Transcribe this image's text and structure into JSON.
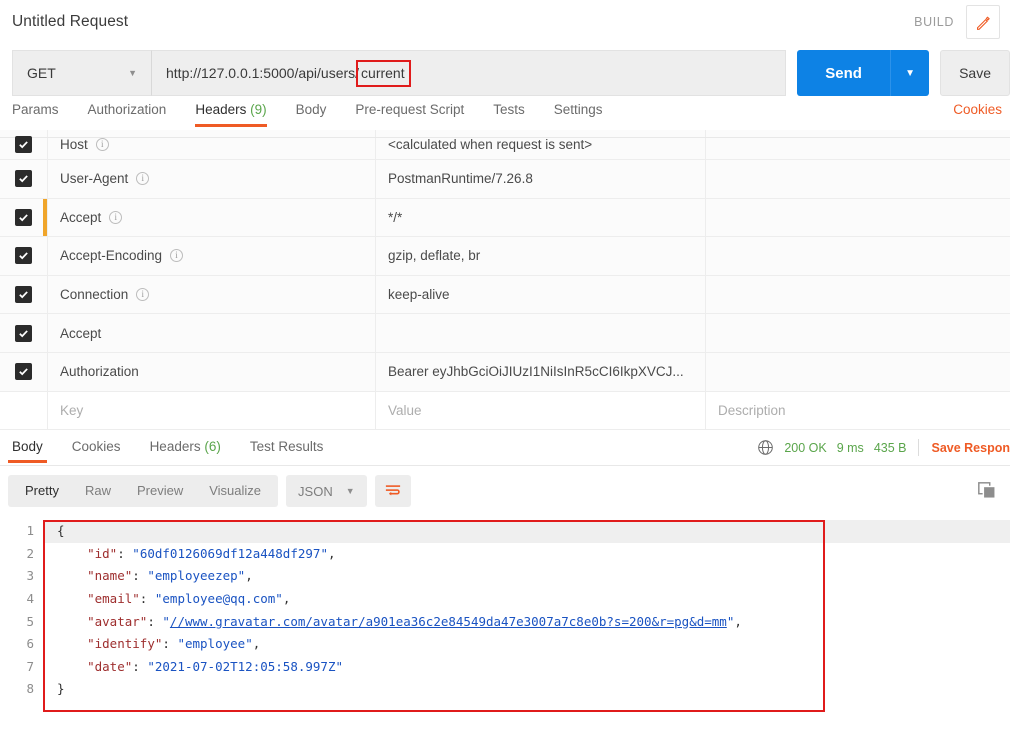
{
  "titlebar": {
    "request_title": "Untitled Request",
    "build_label": "BUILD",
    "edit_icon": "pencil-icon"
  },
  "url_bar": {
    "method": "GET",
    "url_prefix": "http://127.0.0.1:5000/api/users/",
    "url_highlighted": "current",
    "send_label": "Send",
    "save_label": "Save"
  },
  "request_tabs": {
    "items": [
      {
        "label": "Params",
        "count": "",
        "active": false
      },
      {
        "label": "Authorization",
        "count": "",
        "active": false
      },
      {
        "label": "Headers",
        "count": "(9)",
        "active": true
      },
      {
        "label": "Body",
        "count": "",
        "active": false
      },
      {
        "label": "Pre-request Script",
        "count": "",
        "active": false
      },
      {
        "label": "Tests",
        "count": "",
        "active": false
      },
      {
        "label": "Settings",
        "count": "",
        "active": false
      }
    ],
    "cookies_link": "Cookies"
  },
  "headers_table": {
    "columns": {
      "key": "Key",
      "value": "Value",
      "description": "Description"
    },
    "rows": [
      {
        "checked": true,
        "key": "Host",
        "info": true,
        "value": "<calculated when request is sent>",
        "description": "",
        "marker": false
      },
      {
        "checked": true,
        "key": "User-Agent",
        "info": true,
        "value": "PostmanRuntime/7.26.8",
        "description": "",
        "marker": false
      },
      {
        "checked": true,
        "key": "Accept",
        "info": true,
        "value": "*/*",
        "description": "",
        "marker": true
      },
      {
        "checked": true,
        "key": "Accept-Encoding",
        "info": true,
        "value": "gzip, deflate, br",
        "description": "",
        "marker": false
      },
      {
        "checked": true,
        "key": "Connection",
        "info": true,
        "value": "keep-alive",
        "description": "",
        "marker": false
      },
      {
        "checked": true,
        "key": "Accept",
        "info": false,
        "value": "",
        "description": "",
        "marker": false
      },
      {
        "checked": true,
        "key": "Authorization",
        "info": false,
        "value": "Bearer eyJhbGciOiJIUzI1NiIsInR5cCI6IkpXVCJ...",
        "description": "",
        "marker": false
      }
    ]
  },
  "response_tabs": {
    "items": [
      {
        "label": "Body",
        "count": "",
        "active": true
      },
      {
        "label": "Cookies",
        "count": "",
        "active": false
      },
      {
        "label": "Headers",
        "count": "(6)",
        "active": false
      },
      {
        "label": "Test Results",
        "count": "",
        "active": false
      }
    ],
    "status": "200 OK",
    "time": "9 ms",
    "size": "435 B",
    "save_response": "Save Respon",
    "globe_icon": "globe-icon"
  },
  "body_toolbar": {
    "views": [
      {
        "label": "Pretty",
        "active": true
      },
      {
        "label": "Raw",
        "active": false
      },
      {
        "label": "Preview",
        "active": false
      },
      {
        "label": "Visualize",
        "active": false
      }
    ],
    "format": "JSON",
    "wrap_icon": "word-wrap-icon",
    "copy_icon": "copy-icon"
  },
  "json_body": {
    "line_numbers": [
      "1",
      "2",
      "3",
      "4",
      "5",
      "6",
      "7",
      "8"
    ],
    "raw": "{\n    \"id\": \"60df0126069df12a448df297\",\n    \"name\": \"employeezep\",\n    \"email\": \"employee@qq.com\",\n    \"avatar\": \"//www.gravatar.com/avatar/a901ea36c2e84549da47e3007a7c8e0b?s=200&r=pg&d=mm\",\n    \"identify\": \"employee\",\n    \"date\": \"2021-07-02T12:05:58.997Z\"\n}",
    "fields": {
      "id": "60df0126069df12a448df297",
      "name": "employeezep",
      "email": "employee@qq.com",
      "avatar": "//www.gravatar.com/avatar/a901ea36c2e84549da47e3007a7c8e0b?s=200&r=pg&d=mm",
      "identify": "employee",
      "date": "2021-07-02T12:05:58.997Z"
    },
    "keys": {
      "id": "\"id\"",
      "name": "\"name\"",
      "email": "\"email\"",
      "avatar": "\"avatar\"",
      "identify": "\"identify\"",
      "date": "\"date\""
    },
    "brace_open": "{",
    "brace_close": "}"
  },
  "colors": {
    "accent_orange": "#ef5b25",
    "send_blue": "#0d82e5",
    "status_green": "#5aa54b",
    "annotation_red": "#e01b1b",
    "marker_yellow": "#f0a52a",
    "json_key": "#9e2e2e",
    "json_string": "#1a53c2"
  }
}
